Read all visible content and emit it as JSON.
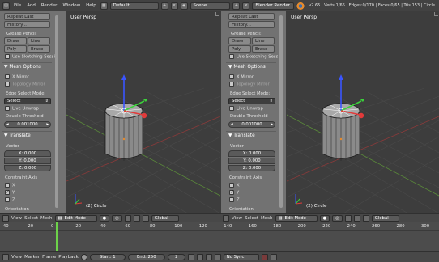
{
  "topbar": {
    "menus": [
      "File",
      "Add",
      "Render",
      "Window",
      "Help"
    ],
    "layout_label": "Default",
    "scene_label": "Scene",
    "engine_label": "Blender Render",
    "stats": "v2.65 | Verts:1/66 | Edges:0/170 | Faces:0/65 | Tris:153 | Circle"
  },
  "left_panel": {
    "repeat_last": "Repeat Last",
    "history": "History...",
    "grease_pencil": "Grease Pencil:",
    "draw": "Draw",
    "line": "Line",
    "poly": "Poly",
    "erase": "Erase",
    "use_sketching": "Use Sketching Sessi",
    "mesh_options": "Mesh Options",
    "x_mirror": "X Mirror",
    "topology_mirror": "Topology Mirror",
    "edge_select_mode": "Edge Select Mode:",
    "select": "Select",
    "live_unwrap": "Live Unwrap",
    "double_threshold": "Double Threshold",
    "threshold_value": "0.001000",
    "translate": "Translate",
    "vector": "Vector",
    "x_val": "X: 0.000",
    "y_val": "Y: 0.000",
    "z_val": "Z: 0.000",
    "constraint_axis": "Constraint Axis",
    "axis_x": "X",
    "axis_y": "Y",
    "axis_z": "Z",
    "orientation": "Orientation"
  },
  "viewport": {
    "title": "User Persp",
    "object_label": "(2) Circle"
  },
  "view_header": {
    "view": "View",
    "select": "Select",
    "mesh": "Mesh",
    "mode": "Edit Mode",
    "orientation": "Global"
  },
  "timeline": {
    "ticks": [
      "-40",
      "-20",
      "0",
      "20",
      "40",
      "60",
      "80",
      "100",
      "120",
      "140",
      "160",
      "180",
      "200",
      "220",
      "240",
      "260",
      "280",
      "300"
    ],
    "current_frame": 1
  },
  "timeline_header": {
    "view": "View",
    "marker": "Marker",
    "frame": "Frame",
    "playback": "Playback",
    "start": "Start: 1",
    "end": "End: 250",
    "current": "2",
    "sync": "No Sync"
  },
  "colors": {
    "accent_orange": "#e58a2d",
    "axis_red": "#e23a3a",
    "axis_green": "#3bd13b",
    "axis_blue": "#3a55ff",
    "frame_green": "#6dd24a"
  }
}
